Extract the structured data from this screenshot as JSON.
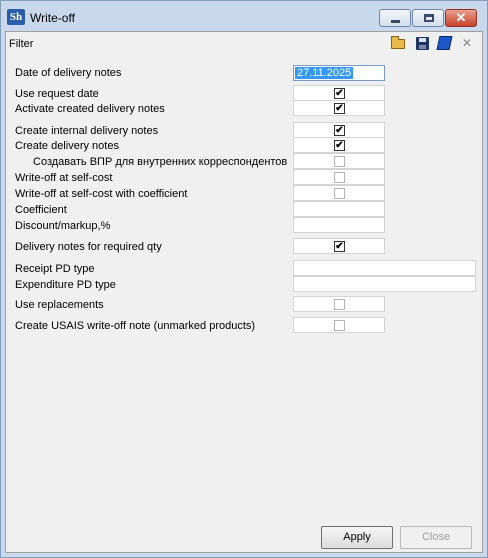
{
  "window": {
    "title": "Write-off",
    "app_icon_text": "Sh"
  },
  "toolbar": {
    "label": "Filter",
    "icons": [
      "open-folder-icon",
      "save-disk-icon",
      "book-icon",
      "close-x-icon"
    ],
    "close_glyph": "✕"
  },
  "form": {
    "date_label": "Date of delivery notes",
    "date_value": "27.11.2025",
    "use_request_date": {
      "label": "Use request date",
      "checked": true
    },
    "activate_created": {
      "label": "Activate created delivery notes",
      "checked": true
    },
    "create_internal": {
      "label": "Create internal delivery notes",
      "checked": true
    },
    "create_delivery": {
      "label": "Create delivery notes",
      "checked": true
    },
    "create_vpr": {
      "label": "Создавать ВПР для внутренних корреспондентов",
      "checked": false
    },
    "writeoff_selfcost": {
      "label": "Write-off at self-cost",
      "checked": false
    },
    "writeoff_selfcost_coef": {
      "label": "Write-off at self-cost with coefficient",
      "checked": false
    },
    "coefficient_label": "Coefficient",
    "coefficient_value": "",
    "discount_label": "Discount/markup,%",
    "discount_value": "",
    "delivery_required_qty": {
      "label": "Delivery notes for required qty",
      "checked": true
    },
    "receipt_pd_label": "Receipt PD type",
    "receipt_pd_value": "",
    "expenditure_pd_label": "Expenditure PD type",
    "expenditure_pd_value": "",
    "use_replacements": {
      "label": "Use replacements",
      "checked": false
    },
    "create_usais": {
      "label": "Create USAIS write-off note (unmarked products)",
      "checked": false
    }
  },
  "buttons": {
    "apply": "Apply",
    "close": "Close"
  },
  "check_glyph": "✔"
}
